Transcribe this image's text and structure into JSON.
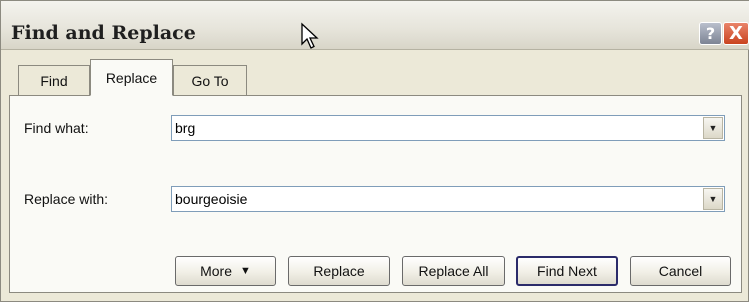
{
  "window": {
    "title": "Find and Replace",
    "help_label": "?",
    "close_label": "X"
  },
  "tabs": [
    {
      "label": "Find",
      "active": false
    },
    {
      "label": "Replace",
      "active": true
    },
    {
      "label": "Go To",
      "active": false
    }
  ],
  "find": {
    "label": "Find what:",
    "value": "brg"
  },
  "replace": {
    "label": "Replace with:",
    "value": "bourgeoisie"
  },
  "buttons": {
    "more": "More",
    "more_arrow": "▼",
    "replace": "Replace",
    "replace_all": "Replace All",
    "find_next": "Find Next",
    "cancel": "Cancel"
  }
}
